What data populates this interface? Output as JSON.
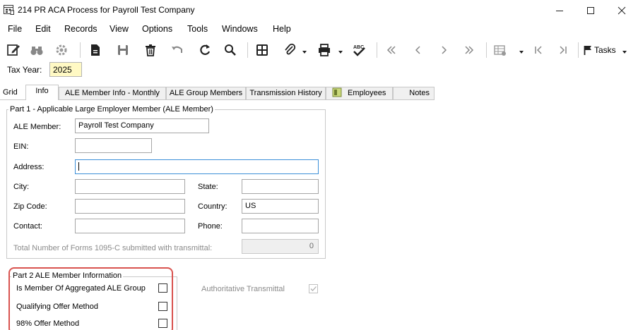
{
  "window": {
    "title": "214 PR ACA Process for Payroll Test Company",
    "app_icon": "calendar-grid-icon",
    "controls": [
      "minimize-icon",
      "maximize-icon",
      "close-icon"
    ]
  },
  "menu": {
    "items": [
      "File",
      "Edit",
      "Records",
      "View",
      "Options",
      "Tools",
      "Windows",
      "Help"
    ]
  },
  "toolbar": {
    "tasks_label": "Tasks",
    "icons": [
      "edit-icon",
      "binoculars-icon",
      "settings-icon",
      "new-document-icon",
      "save-icon",
      "delete-icon",
      "undo-icon",
      "refresh-icon",
      "search-icon",
      "layout-icon",
      "attach-icon",
      "print-icon",
      "spellcheck-icon",
      "first-record-icon",
      "previous-record-icon",
      "next-record-icon",
      "last-record-icon",
      "grid-view-icon",
      "first-icon",
      "last-icon",
      "flag-icon"
    ]
  },
  "tax_year": {
    "label": "Tax Year:",
    "value": "2025"
  },
  "tabs": [
    {
      "label": "Grid"
    },
    {
      "label": "Info",
      "active": true
    },
    {
      "label": "ALE Member Info - Monthly"
    },
    {
      "label": "ALE Group Members"
    },
    {
      "label": "Transmission History"
    },
    {
      "label": "Employees"
    },
    {
      "label": "Notes"
    }
  ],
  "part1": {
    "legend": "Part 1 - Applicable Large Employer Member (ALE Member)",
    "ale_member_label": "ALE Member:",
    "ale_member_value": "Payroll Test Company",
    "ein_label": "EIN:",
    "ein_value": "",
    "address_label": "Address:",
    "address_value": "",
    "city_label": "City:",
    "city_value": "",
    "state_label": "State:",
    "state_value": "",
    "zip_label": "Zip Code:",
    "zip_value": "",
    "country_label": "Country:",
    "country_value": "US",
    "contact_label": "Contact:",
    "contact_value": "",
    "phone_label": "Phone:",
    "phone_value": "",
    "total_forms_label": "Total Number of Forms 1095-C submitted with transmittal:",
    "total_forms_value": "0"
  },
  "part2": {
    "legend": "Part 2 ALE Member Information",
    "aggregated_label": "Is Member Of Aggregated ALE Group",
    "aggregated_checked": false,
    "qualifying_label": "Qualifying Offer Method",
    "qualifying_checked": false,
    "offer98_label": "98% Offer Method",
    "offer98_checked": false,
    "authoritative_label": "Authoritative Transmittal",
    "authoritative_checked": true
  },
  "colors": {
    "highlight": "#d9534f",
    "taxyear_bg": "#fff9c4",
    "focus_border": "#3c8fd8"
  }
}
